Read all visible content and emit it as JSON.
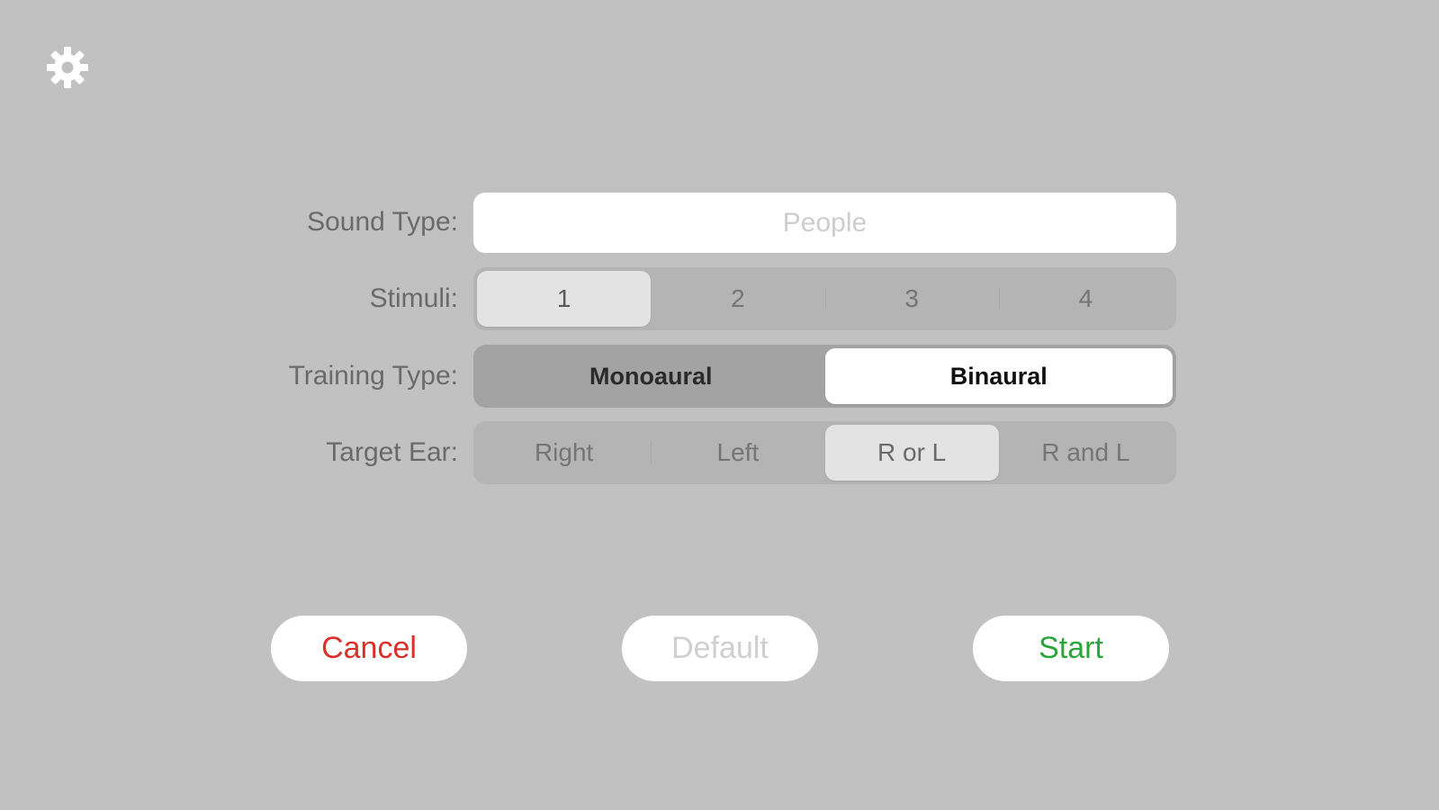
{
  "settings": {
    "icon": "gear-icon"
  },
  "form": {
    "sound_type": {
      "label": "Sound Type:",
      "placeholder": "People"
    },
    "stimuli": {
      "label": "Stimuli:",
      "options": [
        "1",
        "2",
        "3",
        "4"
      ],
      "selected": "1"
    },
    "training_type": {
      "label": "Training Type:",
      "options": [
        "Monoaural",
        "Binaural"
      ],
      "selected": "Binaural"
    },
    "target_ear": {
      "label": "Target Ear:",
      "options": [
        "Right",
        "Left",
        "R or L",
        "R and L"
      ],
      "selected": "R or L"
    }
  },
  "actions": {
    "cancel_label": "Cancel",
    "default_label": "Default",
    "start_label": "Start"
  },
  "colors": {
    "background": "#c1c1c1",
    "cancel": "#d9302a",
    "default": "#cfcfcf",
    "start": "#2aa63a"
  }
}
